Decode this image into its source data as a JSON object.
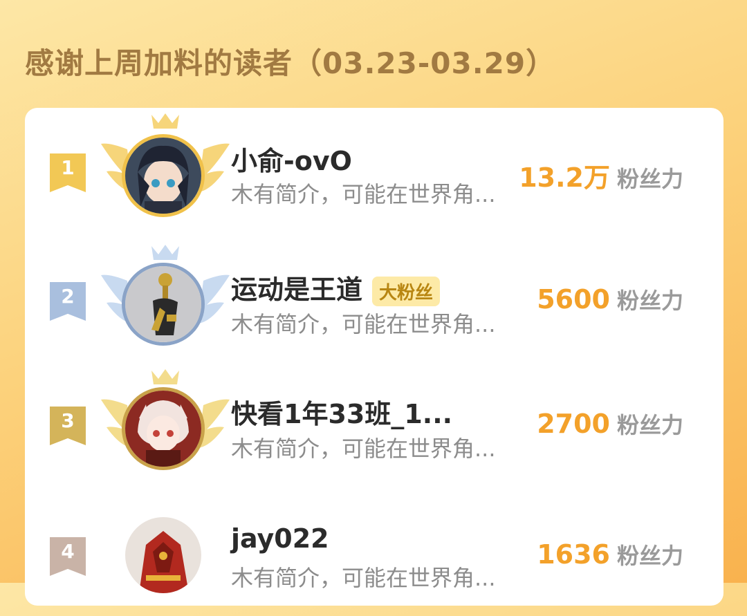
{
  "header": {
    "title": "感谢上周加料的读者（03.23-03.29）"
  },
  "ranking": [
    {
      "rank": "1",
      "name": "小俞-ovO",
      "badge": "",
      "description": "木有简介，可能在世界角...",
      "fans_value": "13.2万",
      "fans_unit": "粉丝力",
      "rank_color": "#f2c855",
      "ring_color": "#f0c14a",
      "avatar_icon": "anime-girl-dark-hair-avatar"
    },
    {
      "rank": "2",
      "name": "运动是王道",
      "badge": "大粉丝",
      "description": "木有简介，可能在世界角...",
      "fans_value": "5600",
      "fans_unit": "粉丝力",
      "rank_color": "#a9bfde",
      "ring_color": "#8aa3c7",
      "avatar_icon": "trophy-avatar"
    },
    {
      "rank": "3",
      "name": "快看1年33班_1...",
      "badge": "",
      "description": "木有简介，可能在世界角...",
      "fans_value": "2700",
      "fans_unit": "粉丝力",
      "rank_color": "#d4b45a",
      "ring_color": "#c9a24a",
      "avatar_icon": "anime-girl-white-hair-avatar"
    },
    {
      "rank": "4",
      "name": "jay022",
      "badge": "",
      "description": "木有简介，可能在世界角...",
      "fans_value": "1636",
      "fans_unit": "粉丝力",
      "rank_color": "#c9b3a7",
      "ring_color": "#ffffff",
      "avatar_icon": "red-mecha-avatar"
    }
  ]
}
